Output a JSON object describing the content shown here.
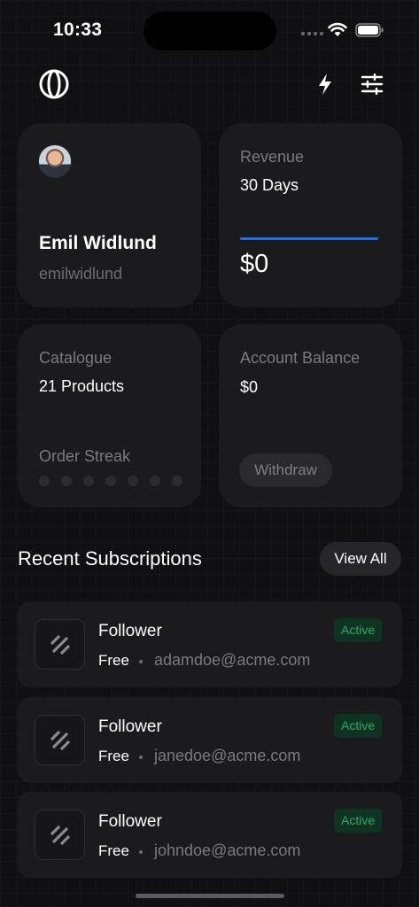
{
  "status_bar": {
    "time": "10:33"
  },
  "profile": {
    "name": "Emil Widlund",
    "handle": "emilwidlund"
  },
  "revenue": {
    "label": "Revenue",
    "period": "30 Days",
    "amount": "$0",
    "accent_color": "#1f6ef0"
  },
  "catalogue": {
    "label": "Catalogue",
    "value": "21 Products",
    "streak_label": "Order Streak",
    "streak_days": 7
  },
  "balance": {
    "label": "Account Balance",
    "value": "$0",
    "withdraw_label": "Withdraw"
  },
  "subscriptions": {
    "title": "Recent Subscriptions",
    "view_all_label": "View All",
    "items": [
      {
        "title": "Follower",
        "tier": "Free",
        "email": "adamdoe@acme.com",
        "status": "Active"
      },
      {
        "title": "Follower",
        "tier": "Free",
        "email": "janedoe@acme.com",
        "status": "Active"
      },
      {
        "title": "Follower",
        "tier": "Free",
        "email": "johndoe@acme.com",
        "status": "Active"
      }
    ]
  },
  "colors": {
    "background": "#101012",
    "card": "#1b1b1e",
    "status_active": "#2ea865"
  },
  "icons": [
    "logo-icon",
    "bolt-icon",
    "sliders-icon",
    "wifi-icon",
    "battery-icon",
    "product-placeholder-icon"
  ]
}
